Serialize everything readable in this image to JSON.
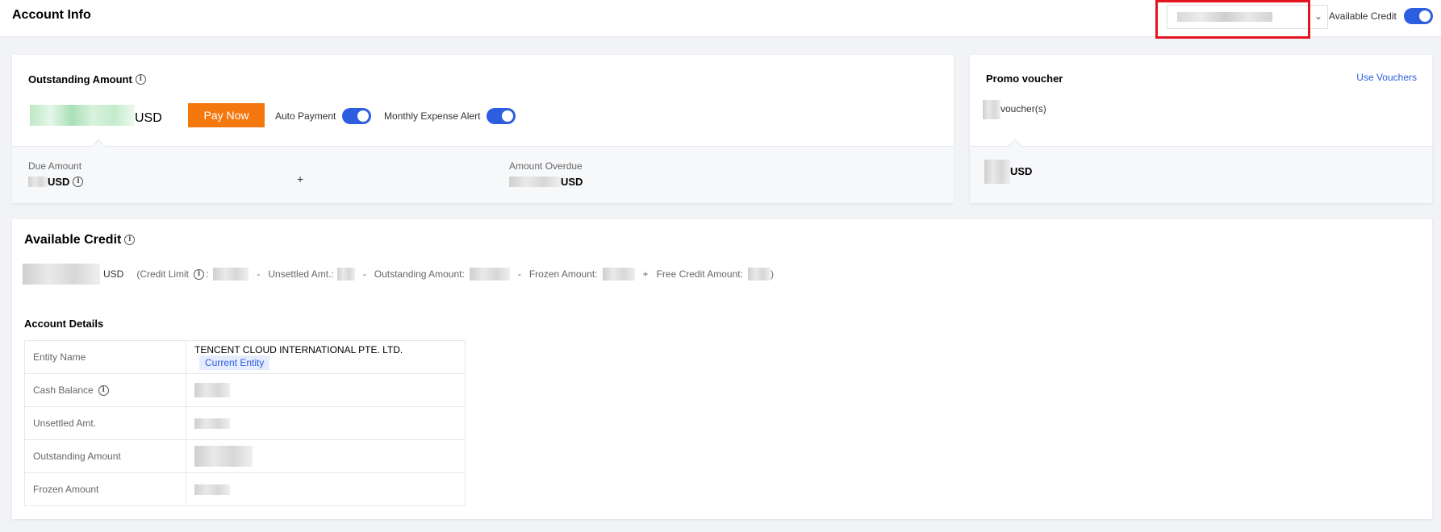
{
  "header": {
    "title": "Account Info",
    "available_credit_label": "Available Credit",
    "available_credit_toggle": true
  },
  "outstanding": {
    "title": "Outstanding Amount",
    "unit": "USD",
    "pay_now": "Pay Now",
    "auto_payment_label": "Auto Payment",
    "auto_payment_on": true,
    "monthly_alert_label": "Monthly Expense Alert",
    "monthly_alert_on": true,
    "due_amount_label": "Due Amount",
    "due_unit": "USD",
    "plus": "+",
    "overdue_label": "Amount Overdue",
    "overdue_unit": "USD"
  },
  "promo": {
    "title": "Promo voucher",
    "use_link": "Use Vouchers",
    "vouchers_suffix": "voucher(s)",
    "unit": "USD"
  },
  "credit": {
    "title": "Available Credit",
    "unit": "USD",
    "credit_limit_label": "(Credit Limit",
    "credit_limit_colon": ":",
    "minus1": "-",
    "unsettled_label": "Unsettled Amt.:",
    "minus2": "-",
    "outstanding_label": "Outstanding Amount:",
    "minus3": "-",
    "frozen_label": "Frozen Amount:",
    "plus": "+",
    "free_credit_label": "Free Credit Amount:",
    "close": ")"
  },
  "details": {
    "title": "Account Details",
    "rows": [
      {
        "label": "Entity Name",
        "value": "TENCENT CLOUD INTERNATIONAL PTE. LTD.",
        "tag": "Current Entity"
      },
      {
        "label": "Cash Balance"
      },
      {
        "label": "Unsettled Amt."
      },
      {
        "label": "Outstanding Amount"
      },
      {
        "label": "Frozen Amount"
      }
    ]
  },
  "icons": [
    "info-icon",
    "chevron-down-icon"
  ],
  "colors": {
    "accent": "#2d5ee0",
    "pay_button": "#f5780f",
    "highlight": "#e3141f"
  }
}
